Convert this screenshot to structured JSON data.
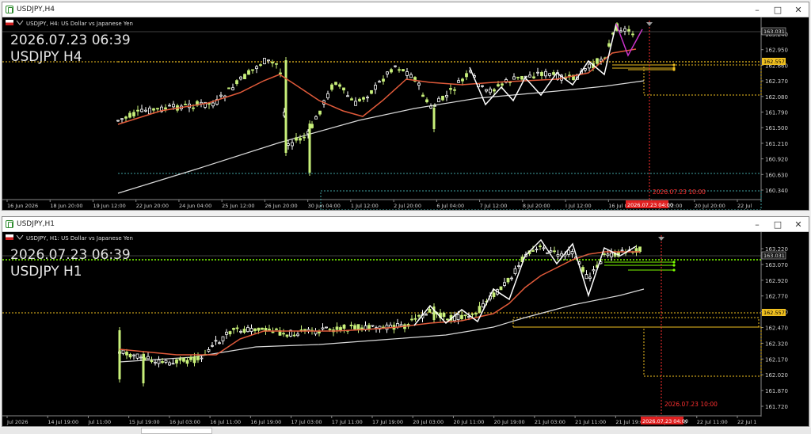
{
  "windows": [
    {
      "title": "USDJPY,H4",
      "symbol_line": "USDJPY, H4: US Dollar vs Japanese Yen",
      "overlay_date": "2026.07.23 06:39",
      "overlay_symbol": "USDJPY H4",
      "price_axis": [
        "163.240",
        "162.950",
        "162.660",
        "162.370",
        "162.080",
        "161.790",
        "161.500",
        "161.210",
        "160.920",
        "160.630",
        "160.340"
      ],
      "current_price": "163.031",
      "line_price": "162.557",
      "time_axis": [
        "16 Jun 2026",
        "18 Jun 20:00",
        "19 Jun 12:00",
        "22 Jun 20:00",
        "24 Jun 04:00",
        "25 Jun 12:00",
        "26 Jun 20:00",
        "30 Jun 04:00",
        "1 Jul 12:00",
        "2 Jul 20:00",
        "6 Jul 04:00",
        "7 Jul 12:00",
        "8 Jul 20:00",
        "I Jul 12:00",
        "16 Jul 04:00",
        "17 Jul 12:00",
        "20 Jul 20:00",
        "22 Jul"
      ],
      "time_badge": "2026.07.23 04:00",
      "vline_label": "2026.07.23 10:00"
    },
    {
      "title": "USDJPY,H1",
      "symbol_line": "USDJPY, H1: US Dollar vs Japanese Yen",
      "overlay_date": "2026.07.23 06:39",
      "overlay_symbol": "USDJPY H1",
      "price_axis": [
        "163.220",
        "163.070",
        "162.920",
        "162.770",
        "162.620",
        "162.470",
        "162.320",
        "162.170",
        "162.020",
        "161.870",
        "161.720"
      ],
      "current_price": "163.031",
      "line_price": "162.557",
      "time_axis": [
        "Jul 2026",
        "14 Jul 19:00",
        "Jul 11:00",
        "15 Jul 19:00",
        "16 Jul 03:00",
        "16 Jul 11:00",
        "16 Jul 19:00",
        "17 Jul 03:00",
        "17 Jul 11:00",
        "17 Jul 19:00",
        "20 Jul 03:00",
        "20 Jul 11:00",
        "20 Jul 19:00",
        "21 Jul 03:00",
        "21 Jul 11:00",
        "21 Jul 19:00",
        "22 Jul 03:00",
        "22 Jul 11:00",
        "22 Jul 1"
      ],
      "time_badge": "2026.07.23 04:00",
      "vline_label": "2026.07.23 10:00"
    }
  ],
  "colors": {
    "bull": "#c8f07a",
    "bear": "#ffffff",
    "ma_fast": "#e05a3a",
    "ma_slow": "#d9d9d9",
    "zigzag": "#ffffff",
    "zigzag_top": "#cc33cc",
    "level_yellow": "#f0c020",
    "level_green": "#7cfc00",
    "vline_red": "#ff3030",
    "badge_red": "#e02020",
    "price_box": "#e0e0e0"
  },
  "icons": [
    "app-chart-icon",
    "minimize-icon",
    "maximize-icon",
    "close-icon",
    "flag-icon"
  ]
}
